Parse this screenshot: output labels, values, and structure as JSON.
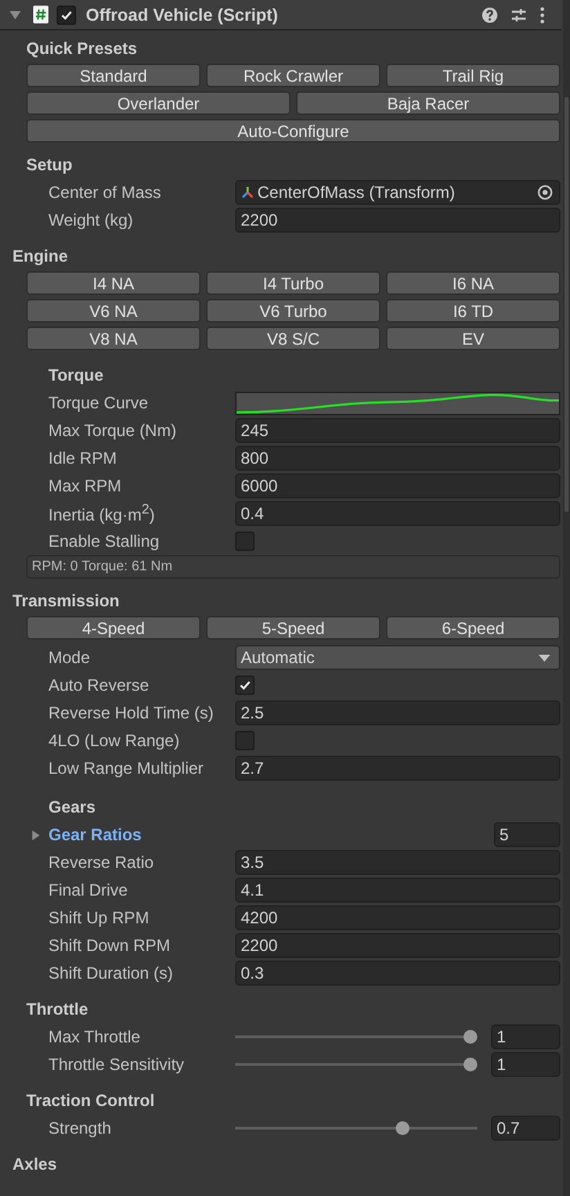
{
  "component": {
    "title": "Offroad Vehicle (Script)",
    "expanded": true,
    "enabled": true
  },
  "sections": [
    {
      "title": "Quick Presets",
      "kind": "minor",
      "rows": [
        {
          "kind": "buttons",
          "buttons": [
            "Standard",
            "Rock Crawler",
            "Trail Rig"
          ]
        },
        {
          "kind": "buttons",
          "buttons": [
            "Overlander",
            "Baja Racer"
          ]
        },
        {
          "kind": "buttons",
          "buttons": [
            "Auto-Configure"
          ]
        }
      ]
    },
    {
      "title": "Setup",
      "kind": "minor",
      "rows": [
        {
          "kind": "object",
          "label": "Center of Mass",
          "value": "CenterOfMass (Transform)"
        },
        {
          "kind": "field",
          "label": "Weight (kg)",
          "value": "2200"
        }
      ]
    },
    {
      "title": "Engine",
      "kind": "major",
      "rows": [
        {
          "kind": "buttons",
          "buttons": [
            "I4 NA",
            "I4 Turbo",
            "I6 NA"
          ]
        },
        {
          "kind": "buttons",
          "buttons": [
            "V6 NA",
            "V6 Turbo",
            "I6 TD"
          ]
        },
        {
          "kind": "buttons",
          "buttons": [
            "V8 NA",
            "V8 S/C",
            "EV"
          ]
        }
      ],
      "children": [
        {
          "title": "Torque",
          "rows": [
            {
              "kind": "curve",
              "label": "Torque Curve"
            },
            {
              "kind": "field",
              "label": "Max Torque (Nm)",
              "value": "245"
            },
            {
              "kind": "field",
              "label": "Idle RPM",
              "value": "800"
            },
            {
              "kind": "field",
              "label": "Max RPM",
              "value": "6000"
            },
            {
              "kind": "field",
              "label": "Inertia (kg·m$^{2}$)",
              "value": "0.4"
            },
            {
              "kind": "checkbox",
              "label": "Enable Stalling",
              "checked": false
            },
            {
              "kind": "info",
              "text": "RPM: 0  Torque: 61 Nm"
            }
          ]
        }
      ]
    },
    {
      "title": "Transmission",
      "kind": "major",
      "rows": [
        {
          "kind": "buttons",
          "buttons": [
            "4-Speed",
            "5-Speed",
            "6-Speed"
          ]
        },
        {
          "kind": "dropdown",
          "label": "Mode",
          "value": "Automatic"
        },
        {
          "kind": "checkbox",
          "label": "Auto Reverse",
          "checked": true
        },
        {
          "kind": "field",
          "label": "Reverse Hold Time (s)",
          "value": "2.5"
        },
        {
          "kind": "checkbox",
          "label": "4LO (Low Range)",
          "checked": false
        },
        {
          "kind": "field",
          "label": "Low Range Multiplier",
          "value": "2.7"
        }
      ],
      "children": [
        {
          "title": "Gears",
          "rows": [
            {
              "kind": "foldout",
              "label": "Gear Ratios",
              "expanded": false,
              "value": "5"
            },
            {
              "kind": "field",
              "label": "Reverse Ratio",
              "value": "3.5"
            },
            {
              "kind": "field",
              "label": "Final Drive",
              "value": "4.1"
            },
            {
              "kind": "field",
              "label": "Shift Up RPM",
              "value": "4200"
            },
            {
              "kind": "field",
              "label": "Shift Down RPM",
              "value": "2200"
            },
            {
              "kind": "field",
              "label": "Shift Duration (s)",
              "value": "0.3"
            }
          ]
        }
      ]
    },
    {
      "title": "Throttle",
      "kind": "minor",
      "rows": [
        {
          "kind": "slider",
          "label": "Max Throttle",
          "level": 1,
          "value": "1"
        },
        {
          "kind": "slider",
          "label": "Throttle Sensitivity",
          "level": 1,
          "value": "1"
        }
      ]
    },
    {
      "title": "Traction Control",
      "kind": "minor",
      "rows": [
        {
          "kind": "slider",
          "label": "Strength",
          "level": 0.7,
          "value": "0.7"
        }
      ]
    },
    {
      "title": "Axles",
      "kind": "major"
    }
  ]
}
